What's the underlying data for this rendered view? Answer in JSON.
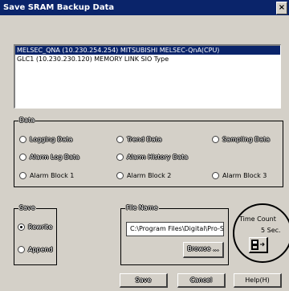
{
  "window": {
    "title": "Save SRAM Backup Data",
    "close_glyph": "×"
  },
  "device_list": {
    "items": [
      {
        "text": "MELSEC_QNA (10.230.254.254) MITSUBISHI MELSEC-QnA(CPU)",
        "selected": true
      },
      {
        "text": "GLC1 (10.230.230.120) MEMORY LINK SIO Type",
        "selected": false
      }
    ]
  },
  "data_group": {
    "label": "Data",
    "options": [
      "Logging Data",
      "Trend Data",
      "Sampling Data",
      "Alarm Log Data",
      "Alarm History Data",
      "Alarm Block 1",
      "Alarm Block 2",
      "Alarm Block 3"
    ]
  },
  "save_group": {
    "label": "Save",
    "options": [
      {
        "label": "Rewrite",
        "checked": true
      },
      {
        "label": "Append",
        "checked": false
      }
    ]
  },
  "file_group": {
    "label": "File Name",
    "path_value": "C:\\Program Files\\Digital\\Pro-Server with St",
    "browse_label": "Browse ..."
  },
  "time_count": {
    "label": "Time Count",
    "value": "5 Sec.",
    "icon": "timer-save-icon"
  },
  "buttons": {
    "save": "Save",
    "cancel": "Cancel",
    "help": "Help(H)"
  }
}
